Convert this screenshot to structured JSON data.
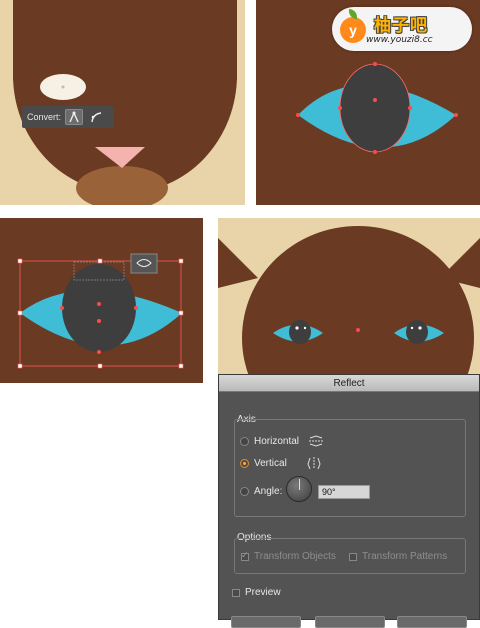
{
  "convert_toolbar": {
    "label": "Convert:"
  },
  "watermark": {
    "logo_letter": "y",
    "title": "柚子吧",
    "url": "www.youzi8.cc"
  },
  "dialog": {
    "title": "Reflect",
    "axis": {
      "label": "Axis",
      "options": [
        {
          "label": "Horizontal",
          "selected": false
        },
        {
          "label": "Vertical",
          "selected": true
        }
      ],
      "angle_label": "Angle:",
      "angle_value": "90°"
    },
    "options": {
      "label": "Options",
      "transform_objects": {
        "label": "Transform Objects",
        "checked": true,
        "enabled": false
      },
      "transform_patterns": {
        "label": "Transform Patterns",
        "checked": false,
        "enabled": false
      }
    },
    "preview": {
      "label": "Preview",
      "checked": false
    }
  },
  "colors": {
    "fur_brown": "#6b3a22",
    "cream": "#e8d4a8",
    "eye_blue": "#3fbcd6",
    "pupil_gray": "#3e3e3e",
    "nose_pink": "#f4b3ae",
    "anchor_red": "#ff4a4a"
  }
}
